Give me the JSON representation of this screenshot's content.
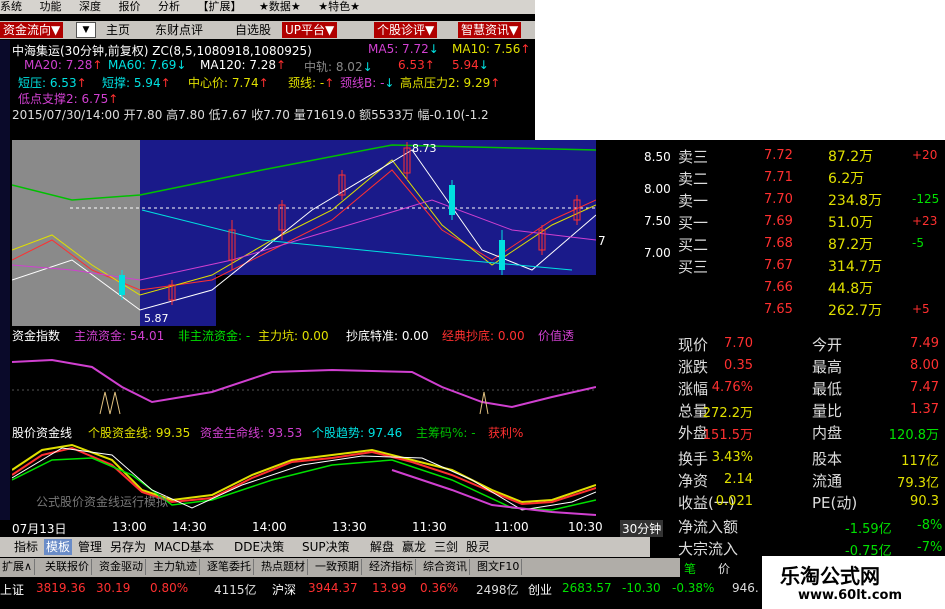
{
  "menu": [
    "系统",
    "功能",
    "深度",
    "报价",
    "分析",
    "【扩展】",
    "★数据★",
    "★特色★"
  ],
  "toolbar": {
    "dropdown": "资金流向▼",
    "items": [
      "主页",
      "东财点评",
      "自选股"
    ],
    "red_items": [
      "UP平台▼",
      "个股诊评▼",
      "智慧资讯▼"
    ]
  },
  "chart_header": {
    "title": "中海集运(30分钟,前复权) ZC(8,5,1080918,1080925)",
    "ma5": "MA5: 7.72",
    "ma10": "MA10: 7.56",
    "ma20": "MA20: 7.28",
    "ma60": "MA60: 7.69",
    "ma120": "MA120: 7.28",
    "zhongzhou": "中轨: 8.02",
    "v1": "6.53",
    "v2": "5.94",
    "duanya": "短压: 6.53",
    "duancheng": "短撑: 5.94",
    "zhongxin": "中心价: 7.74",
    "jingxian": "颈线: -",
    "jingxianB": "颈线B: -",
    "gaodian": "高点压力2: 9.29",
    "didian": "低点支撑2: 6.75",
    "bar_info": "2015/07/30/14:00 开7.80 高7.80 低7.67 收7.70 量71619.0 额5533万 幅-0.10(-1.2"
  },
  "price_axis": [
    "8.50",
    "8.00",
    "7.50",
    "7.00"
  ],
  "chart_labels": {
    "high": "8.73",
    "low": "5.87",
    "right": "7"
  },
  "indicator1": {
    "name": "资金指数",
    "items": [
      {
        "label": "主流资金: 54.01",
        "color": "#d040d0"
      },
      {
        "label": "非主流资金: -",
        "color": "#00e000"
      },
      {
        "label": "主力坑: 0.00",
        "color": "#e0e000"
      },
      {
        "label": "抄底特准: 0.00",
        "color": "#ffffff"
      },
      {
        "label": "经典抄底: 0.00",
        "color": "#ff3030"
      },
      {
        "label": "价值透",
        "color": "#d040d0"
      }
    ]
  },
  "indicator2": {
    "name": "股价资金线",
    "items": [
      {
        "label": "个股资金线: 99.35",
        "color": "#e0e000"
      },
      {
        "label": "资金生命线: 93.53",
        "color": "#d040d0"
      },
      {
        "label": "个股趋势: 97.46",
        "color": "#00e0e0"
      },
      {
        "label": "主筹码%: -",
        "color": "#00c000"
      },
      {
        "label": "获利%",
        "color": "#ff3030"
      }
    ],
    "watermark": "公式股价资金线运行模拟"
  },
  "time_axis": [
    "07月13日",
    "13:00",
    "14:30",
    "14:00",
    "13:30",
    "11:30",
    "11:00",
    "10:30"
  ],
  "period": "30分钟",
  "tabs": [
    "指标",
    "模板",
    "管理",
    "另存为",
    "MACD基本",
    "DDE决策",
    "SUP决策",
    "解盘",
    "赢龙",
    "三剑",
    "股灵"
  ],
  "tabs2": [
    "扩展∧",
    "关联报价",
    "资金驱动",
    "主力轨迹",
    "逐笔委托",
    "热点题材",
    "一致预期",
    "经济指标",
    "综合资讯",
    "图文F10"
  ],
  "order_book": [
    {
      "label": "卖三",
      "price": "7.72",
      "vol": "87.2万",
      "chg": "+20"
    },
    {
      "label": "卖二",
      "price": "7.71",
      "vol": "6.2万",
      "chg": ""
    },
    {
      "label": "卖一",
      "price": "7.70",
      "vol": "234.8万",
      "chg": "-125"
    },
    {
      "label": "买一",
      "price": "7.69",
      "vol": "51.0万",
      "chg": "+23"
    },
    {
      "label": "买二",
      "price": "7.68",
      "vol": "87.2万",
      "chg": "-5"
    },
    {
      "label": "买三",
      "price": "7.67",
      "vol": "314.7万",
      "chg": ""
    },
    {
      "label": "",
      "price": "7.66",
      "vol": "44.8万",
      "chg": ""
    },
    {
      "label": "",
      "price": "7.65",
      "vol": "262.7万",
      "chg": "+5"
    }
  ],
  "stats": [
    {
      "l1": "现价",
      "v1": "7.70",
      "c1": "#ff3030",
      "l2": "今开",
      "v2": "7.49",
      "c2": "#ff3030"
    },
    {
      "l1": "涨跌",
      "v1": "0.35",
      "c1": "#ff3030",
      "l2": "最高",
      "v2": "8.00",
      "c2": "#ff3030"
    },
    {
      "l1": "涨幅",
      "v1": "4.76%",
      "c1": "#ff3030",
      "l2": "最低",
      "v2": "7.47",
      "c2": "#ff3030"
    },
    {
      "l1": "总量",
      "v1": "272.2万",
      "c1": "#e0e000",
      "l2": "量比",
      "v2": "1.37",
      "c2": "#ff3030"
    },
    {
      "l1": "外盘",
      "v1": "151.5万",
      "c1": "#ff3030",
      "l2": "内盘",
      "v2": "120.8万",
      "c2": "#00e000"
    },
    {
      "l1": "换手",
      "v1": "3.43%",
      "c1": "#e0e000",
      "l2": "股本",
      "v2": "117亿",
      "c2": "#e0e000"
    },
    {
      "l1": "净资",
      "v1": "2.14",
      "c1": "#e0e000",
      "l2": "流通",
      "v2": "79.3亿",
      "c2": "#e0e000"
    },
    {
      "l1": "收益(一)",
      "v1": "0.021",
      "c1": "#e0e000",
      "l2": "PE(动)",
      "v2": "90.3",
      "c2": "#e0e000"
    }
  ],
  "net_flow": {
    "label": "净流入额",
    "value": "-1.59亿",
    "pct": "-8%"
  },
  "big_order": {
    "label": "大宗流入",
    "value": "-0.75亿",
    "pct": "-7%"
  },
  "bottom_right_tabs": [
    "笔",
    "价"
  ],
  "status": {
    "sh_label": "上证",
    "sh_value": "3819.36",
    "sh_chg": "30.19",
    "sh_pct": "0.80%",
    "sh_amt": "4115亿",
    "hs_label": "沪深",
    "hs_value": "3944.37",
    "hs_chg": "13.99",
    "hs_pct": "0.36%",
    "hs_amt": "2498亿",
    "cy_label": "创业",
    "cy_value": "2683.57",
    "cy_chg": "-10.30",
    "cy_pct": "-0.38%",
    "cy_amt": "946."
  },
  "site": {
    "name": "乐淘公式网",
    "url": "www.60lt.com"
  }
}
